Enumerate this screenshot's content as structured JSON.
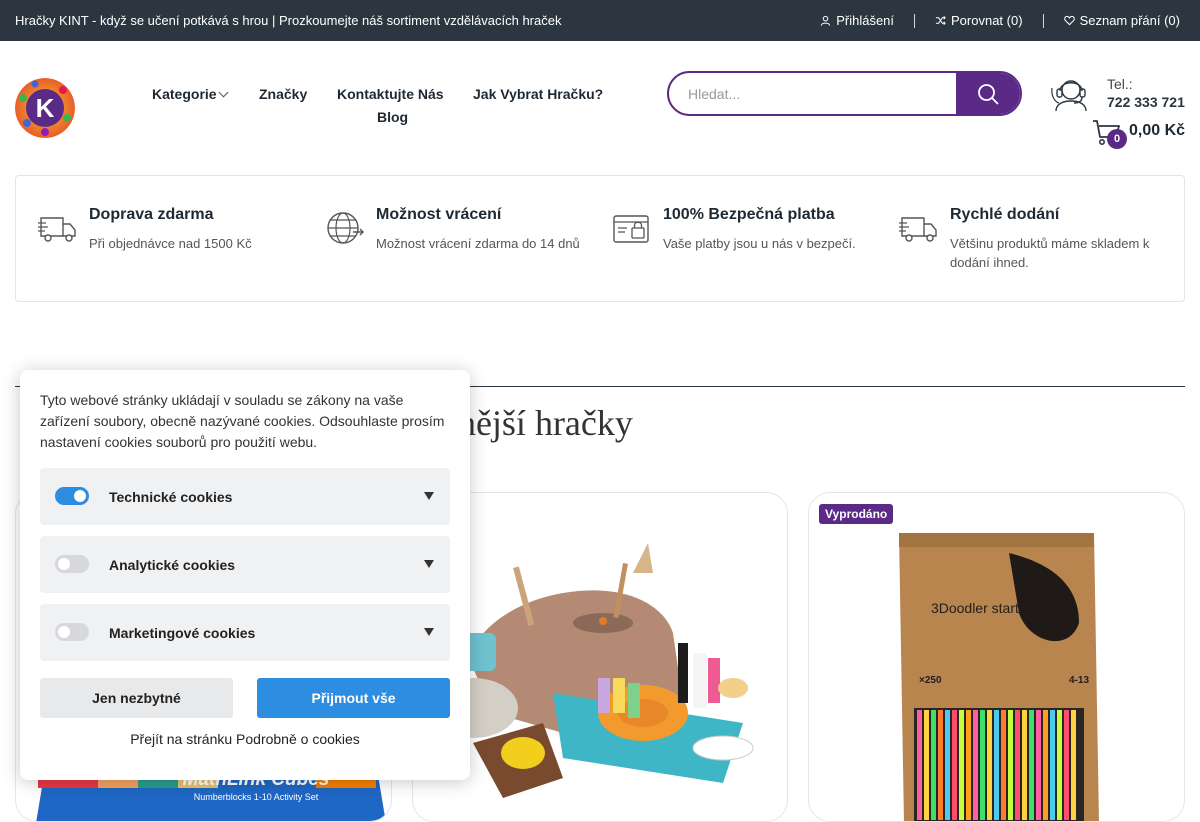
{
  "topbar": {
    "promo": " Hračky KINT - když se učení potkává s hrou  | Prozkoumejte náš sortiment vzdělávacích hraček ",
    "login": "Přihlášení",
    "compare": "Porovnat (0)",
    "wishlist": "Seznam přání (0)"
  },
  "logo": {
    "letter": "K"
  },
  "nav": {
    "categories": "Kategorie",
    "brands": "Značky",
    "contact": "Kontaktujte Nás",
    "how_to_choose": "Jak Vybrat Hračku?",
    "blog": "Blog"
  },
  "search": {
    "placeholder": "Hledat..."
  },
  "contact": {
    "label": "Tel.:",
    "phone": "722 333 721"
  },
  "cart": {
    "count": "0",
    "total": "0,00 Kč"
  },
  "features": [
    {
      "title": "Doprava zdarma",
      "desc": "Při objednávce nad 1500 Kč"
    },
    {
      "title": "Možnost vrácení",
      "desc": "Možnost vrácení zdarma do 14 dnů"
    },
    {
      "title": "100% Bezpečná platba",
      "desc": "Vaše platby jsou u nás v bezpečí."
    },
    {
      "title": "Rychlé dodání",
      "desc": "Většinu produktů máme skladem k dodání ihned."
    }
  ],
  "section": {
    "title": "rodávanější hračky"
  },
  "products": [
    {
      "badge": "",
      "image_text": "MathLink Cubes",
      "image_subtext": "Numberblocks 1-10 Activity Set"
    },
    {
      "badge": ""
    },
    {
      "badge": "Vyprodáno",
      "image_brand": "3Doodler start+",
      "image_count": "×250",
      "image_age": "4-13"
    }
  ],
  "cookies": {
    "intro": "Tyto webové stránky ukládají v souladu se zákony na vaše zařízení soubory, obecně nazývané cookies. Odsouhlaste prosím nastavení cookies souborů pro použití webu.",
    "groups": [
      {
        "label": "Technické cookies",
        "enabled": true
      },
      {
        "label": "Analytické cookies",
        "enabled": false
      },
      {
        "label": "Marketingové cookies",
        "enabled": false
      }
    ],
    "btn_necessary": "Jen nezbytné",
    "btn_accept": "Přijmout vše",
    "details_link": "Přejít na stránku Podrobně o cookies"
  },
  "colors": {
    "brand": "#5b2a86",
    "topbar": "#2b3640",
    "accept": "#2d8de0"
  }
}
